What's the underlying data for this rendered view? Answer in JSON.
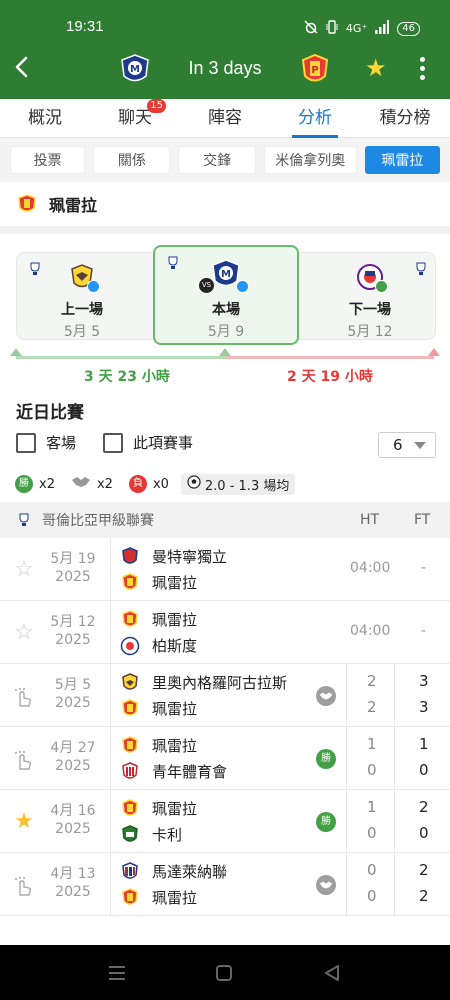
{
  "status_bar": {
    "time": "19:31",
    "signal": "4G⁺",
    "battery": "46"
  },
  "header": {
    "title": "In 3 days"
  },
  "tabs": [
    {
      "label": "概況"
    },
    {
      "label": "聊天",
      "badge": "15"
    },
    {
      "label": "陣容"
    },
    {
      "label": "分析"
    },
    {
      "label": "積分榜"
    }
  ],
  "subtabs": [
    "投票",
    "關係",
    "交鋒",
    "米倫拿列奧",
    "珮雷拉"
  ],
  "team": {
    "name": "珮雷拉"
  },
  "timeline": {
    "prev": {
      "label": "上一場",
      "date": "5月 5"
    },
    "current": {
      "label": "本場",
      "date": "5月 9",
      "vs": "VS"
    },
    "next": {
      "label": "下一場",
      "date": "5月 12"
    },
    "countdown_past": "3 天 23 小時",
    "countdown_future": "2 天 19 小時"
  },
  "recent": {
    "title": "近日比賽",
    "filter_away": "客場",
    "filter_comp": "此項賽事",
    "count": "6",
    "win_label": "勝",
    "wins": "x2",
    "draws": "x2",
    "lose_label": "負",
    "losses": "x0",
    "avg": "2.0 - 1.3 場均"
  },
  "table": {
    "league": "哥倫比亞甲級聯賽",
    "ht": "HT",
    "ft": "FT",
    "rows": [
      {
        "date": "5月 19",
        "year": "2025",
        "home": "曼特寧獨立",
        "away": "珮雷拉",
        "time": "04:00",
        "ft": "-"
      },
      {
        "date": "5月 12",
        "year": "2025",
        "home": "珮雷拉",
        "away": "柏斯度",
        "time": "04:00",
        "ft": "-"
      },
      {
        "date": "5月 5",
        "year": "2025",
        "home": "里奧內格羅阿古拉斯",
        "away": "珮雷拉",
        "ht1": "2",
        "ht2": "2",
        "ft1": "3",
        "ft2": "3"
      },
      {
        "date": "4月 27",
        "year": "2025",
        "home": "珮雷拉",
        "away": "青年體育會",
        "ht1": "1",
        "ht2": "0",
        "ft1": "1",
        "ft2": "0",
        "result": "勝"
      },
      {
        "date": "4月 16",
        "year": "2025",
        "home": "珮雷拉",
        "away": "卡利",
        "ht1": "1",
        "ht2": "0",
        "ft1": "2",
        "ft2": "0",
        "result": "勝"
      },
      {
        "date": "4月 13",
        "year": "2025",
        "home": "馬達萊納聯",
        "away": "珮雷拉",
        "ht1": "0",
        "ht2": "0",
        "ft1": "2",
        "ft2": "2"
      }
    ]
  },
  "colors": {
    "primary": "#2e7d32",
    "accent": "#1976d2",
    "win": "#43a047",
    "lose": "#e53935",
    "star": "#fdd835"
  }
}
